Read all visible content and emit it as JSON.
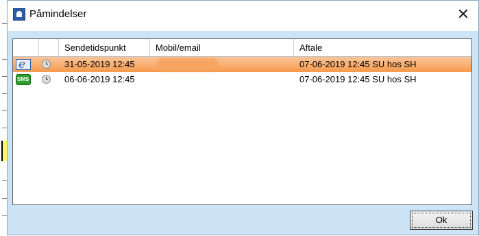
{
  "window": {
    "title": "Påmindelser",
    "close_label": "✕"
  },
  "table": {
    "columns": [
      "Sendetidspunkt",
      "Mobil/email",
      "Aftale"
    ],
    "rows": [
      {
        "type": "email",
        "type_icon_text": "e",
        "sendetidspunkt": "31-05-2019 12:45",
        "mobil_email": "",
        "aftale": "07-06-2019 12:45 SU  hos SH",
        "selected": true
      },
      {
        "type": "sms",
        "type_icon_text": "SMS",
        "sendetidspunkt": "06-06-2019 12:45",
        "mobil_email": "",
        "aftale": "07-06-2019 12:45 SU  hos SH",
        "selected": false
      }
    ]
  },
  "footer": {
    "ok_label": "Ok"
  },
  "colors": {
    "selection": "#f59a4c",
    "dialog_bg": "#cde3f6",
    "sms_icon": "#2e9e2e",
    "email_icon": "#2c5fa0"
  }
}
